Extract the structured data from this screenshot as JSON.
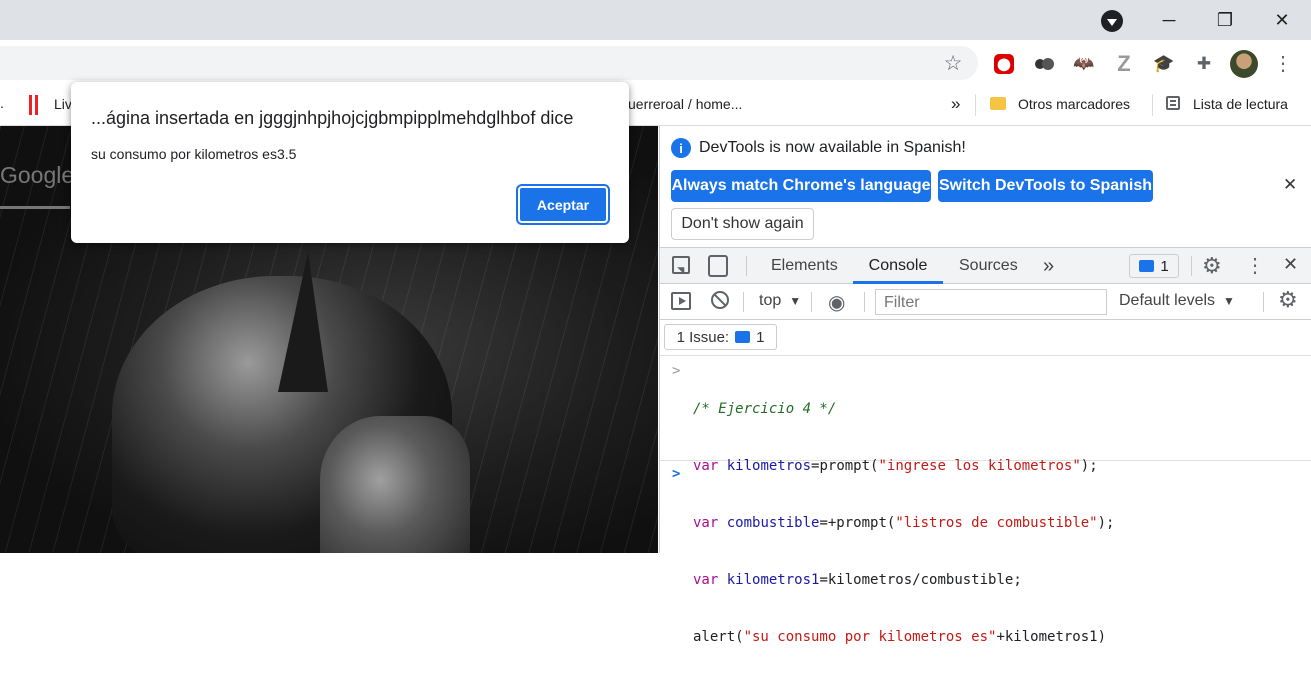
{
  "window": {
    "minimize": "─",
    "maximize": "❐",
    "close": "✕"
  },
  "toolbar": {
    "star_icon": "star-icon",
    "menu": "⋮",
    "extensions": [
      "ublock-icon",
      "dots-extension-icon",
      "bat-extension-icon",
      "z-extension-icon",
      "graduation-cap-extension-icon",
      "puzzle-icon",
      "profile-avatar"
    ]
  },
  "bookmarks": {
    "item_fragment_1": ".",
    "item_fragment_2": "Liv",
    "item_fragment_3": "uerreroal / home...",
    "more": "»",
    "otros": "Otros marcadores",
    "lista": "Lista de lectura"
  },
  "page": {
    "search_fragment": "Google"
  },
  "dialog": {
    "title": "...ágina insertada en jgggjnhpjhojcjgbmpipplmehdglhbof dice",
    "message": "su consumo por kilometros es3.5",
    "ok_label": "Aceptar"
  },
  "devtools": {
    "notice": "DevTools is now available in Spanish!",
    "btn_match": "Always match Chrome's language",
    "btn_switch": "Switch DevTools to Spanish",
    "btn_dont_show": "Don't show again",
    "tabs": [
      "Elements",
      "Console",
      "Sources"
    ],
    "active_tab": "Console",
    "more_tabs": "»",
    "issues_badge": "1",
    "context": "top",
    "filter_placeholder": "Filter",
    "levels": "Default levels",
    "issues_label": "1 Issue:",
    "issues_count": "1",
    "prompt_in": ">",
    "prompt_new": ">",
    "code_lines": [
      "/* Ejercicio 4 */",
      "var kilometros=prompt(\"ingrese los kilometros\");",
      "var combustible=+prompt(\"listros de combustible\");",
      "var kilometros1=kilometros/combustible;",
      "alert(\"su consumo por kilometros es\"+kilometros1)"
    ]
  }
}
